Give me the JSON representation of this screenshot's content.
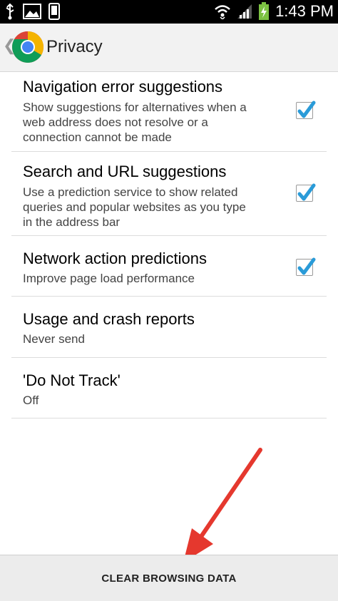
{
  "status_bar": {
    "time": "1:43 PM",
    "icons": [
      "usb-icon",
      "image-icon",
      "phone-icon",
      "wifi-icon",
      "signal-icon",
      "battery-charging-icon"
    ]
  },
  "action_bar": {
    "title": "Privacy",
    "logo": "chrome-icon"
  },
  "settings": [
    {
      "title": "Navigation error suggestions",
      "summary": "Show suggestions for alternatives when a web address does not resolve or a connection cannot be made",
      "checked": true
    },
    {
      "title": "Search and URL suggestions",
      "summary": "Use a prediction service to show related queries and popular websites as you type in the address bar",
      "checked": true
    },
    {
      "title": "Network action predictions",
      "summary": "Improve page load performance",
      "checked": true
    },
    {
      "title": "Usage and crash reports",
      "summary": "Never send"
    },
    {
      "title": "'Do Not Track'",
      "summary": "Off"
    }
  ],
  "bottom_button": {
    "label": "CLEAR BROWSING DATA"
  },
  "colors": {
    "checkmark": "#2a9bd8",
    "arrow": "#e5382e"
  }
}
